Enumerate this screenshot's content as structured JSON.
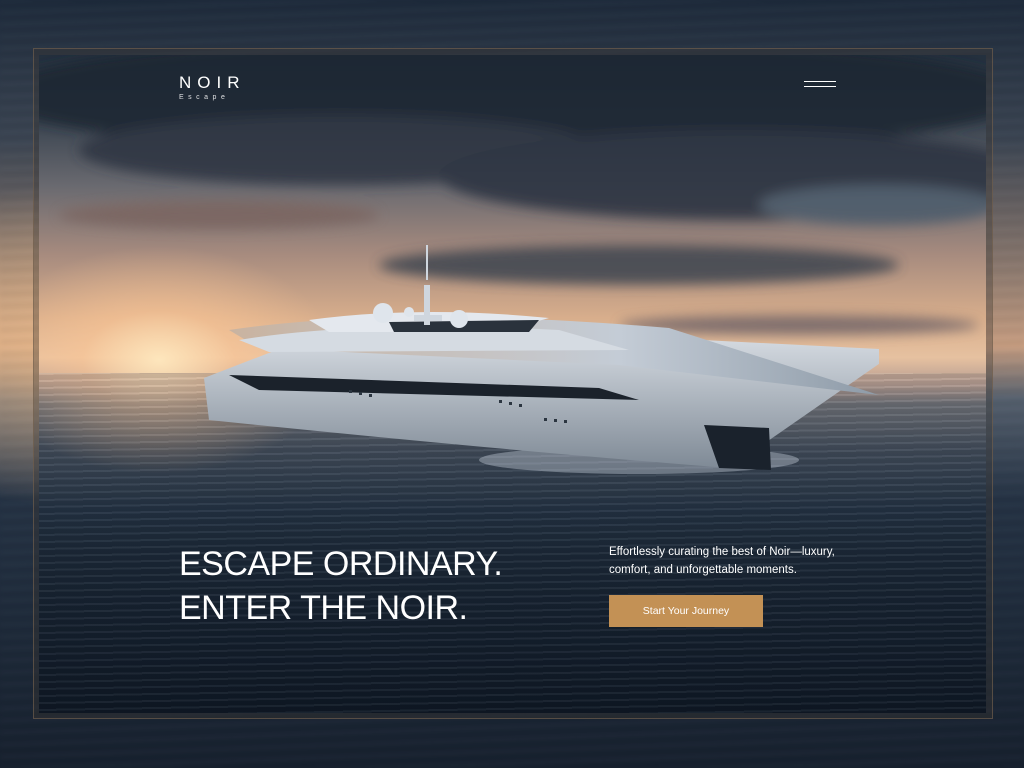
{
  "brand": {
    "name": "NOIR",
    "sub": "Escape"
  },
  "nav": {
    "menu_icon": "hamburger-menu-icon"
  },
  "hero": {
    "headline_line1": "ESCAPE ORDINARY.",
    "headline_line2": "ENTER THE NOIR.",
    "tagline": "Effortlessly curating the best of Noir—luxury, comfort, and unforgettable moments.",
    "cta_label": "Start Your Journey",
    "image": "luxury-yacht-sunset-image"
  },
  "colors": {
    "accent": "#c39155",
    "text": "#ffffff",
    "frame": "#786450"
  }
}
